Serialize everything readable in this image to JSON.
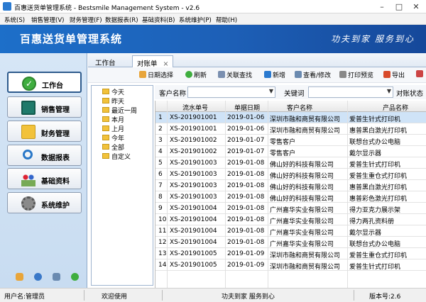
{
  "window": {
    "title": "百惠送货单管理系统 - Bestsmile Management System - v2.6"
  },
  "menu": [
    "系统(S)",
    "销售管理(V)",
    "财务管理(F)",
    "数据报表(R)",
    "基础资料(B)",
    "系统维护(P)",
    "帮助(H)"
  ],
  "banner": {
    "title": "百惠送货单管理系统",
    "slogan": "功夫到家 服务到心"
  },
  "nav": [
    {
      "label": "工作台",
      "icon": "checkmark-icon"
    },
    {
      "label": "销售管理",
      "icon": "sales-icon"
    },
    {
      "label": "财务管理",
      "icon": "folder-icon"
    },
    {
      "label": "数据报表",
      "icon": "magnifier-icon"
    },
    {
      "label": "基础资料",
      "icon": "people-icon"
    },
    {
      "label": "系统维护",
      "icon": "gear-icon"
    }
  ],
  "tabs": [
    {
      "label": "工作台"
    },
    {
      "label": "对账单",
      "close": "×"
    }
  ],
  "toolbar": [
    "日期选择",
    "刷新",
    "关联查找",
    "新增",
    "查看/修改",
    "打印预览",
    "导出"
  ],
  "tree": [
    "今天",
    "昨天",
    "最近一周",
    "本月",
    "上月",
    "今年",
    "全部",
    "自定义"
  ],
  "filter": {
    "customer_label": "客户名称",
    "keyword_label": "关键词",
    "status_label": "对账状态"
  },
  "grid": {
    "columns": [
      "",
      "流水单号",
      "单据日期",
      "客户名称",
      "产品名称"
    ],
    "rows": [
      [
        "1",
        "XS-201901001",
        "2019-01-06",
        "深圳市融和商贸有限公司",
        "爱普生针式打印机"
      ],
      [
        "2",
        "XS-201901001",
        "2019-01-06",
        "深圳市融和商贸有限公司",
        "惠普黑白激光打印机"
      ],
      [
        "3",
        "XS-201901002",
        "2019-01-07",
        "零售客户",
        "联想台式办公电脑"
      ],
      [
        "4",
        "XS-201901002",
        "2019-01-07",
        "零售客户",
        "戴尔显示器"
      ],
      [
        "5",
        "XS-201901003",
        "2019-01-08",
        "佛山好的科技有限公司",
        "爱普生针式打印机"
      ],
      [
        "6",
        "XS-201901003",
        "2019-01-08",
        "佛山好的科技有限公司",
        "爱普生重仓式打印机"
      ],
      [
        "7",
        "XS-201901003",
        "2019-01-08",
        "佛山好的科技有限公司",
        "惠普黑白激光打印机"
      ],
      [
        "8",
        "XS-201901003",
        "2019-01-08",
        "佛山好的科技有限公司",
        "惠普彩色激光打印机"
      ],
      [
        "9",
        "XS-201901004",
        "2019-01-08",
        "广州嘉华实业有限公司",
        "得力亚克力展示架"
      ],
      [
        "10",
        "XS-201901004",
        "2019-01-08",
        "广州嘉华实业有限公司",
        "得力两孔资料册"
      ],
      [
        "11",
        "XS-201901004",
        "2019-01-08",
        "广州嘉华实业有限公司",
        "戴尔显示器"
      ],
      [
        "12",
        "XS-201901004",
        "2019-01-08",
        "广州嘉华实业有限公司",
        "联想台式办公电脑"
      ],
      [
        "13",
        "XS-201901005",
        "2019-01-09",
        "深圳市融和商贸有限公司",
        "爱普生重仓式打印机"
      ],
      [
        "14",
        "XS-201901005",
        "2019-01-09",
        "深圳市融和商贸有限公司",
        "爱普生针式打印机"
      ]
    ]
  },
  "status": {
    "user": "用户名:管理员",
    "welcome": "欢迎使用",
    "slogan": "功夫到家 服务到心",
    "version": "版本号:2.6"
  },
  "colors": {
    "banner": "#1d6fc9",
    "accent": "#2a7ad0",
    "selected_row": "#cfe3f7"
  }
}
